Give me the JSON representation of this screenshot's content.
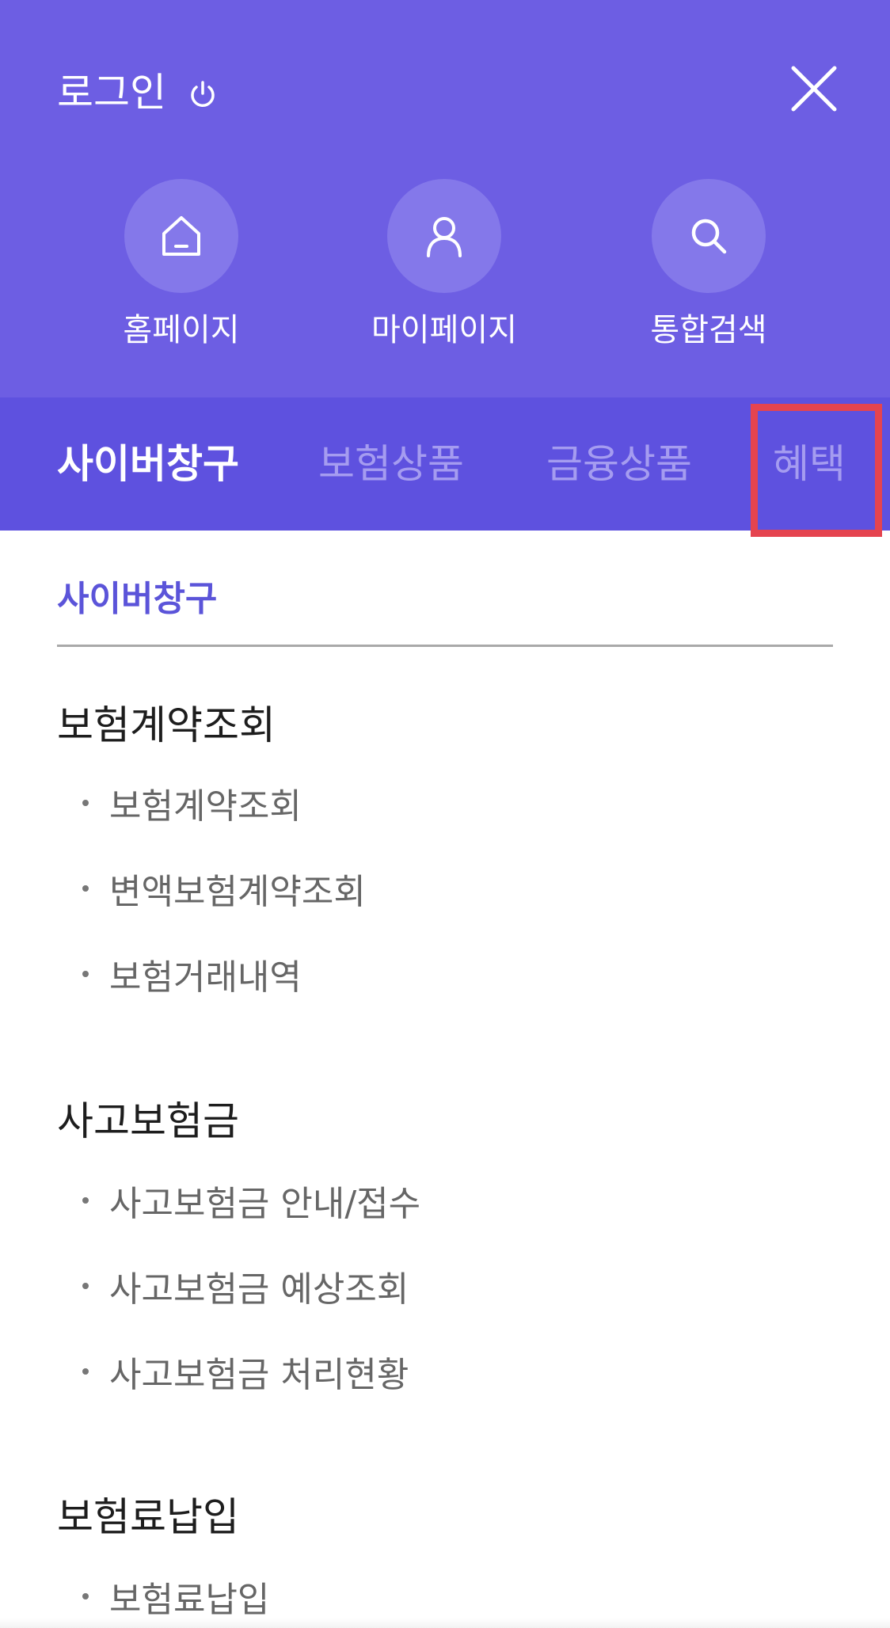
{
  "header": {
    "login_label": "로그인",
    "quick_links": [
      {
        "label": "홈페이지",
        "icon": "home-icon"
      },
      {
        "label": "마이페이지",
        "icon": "person-icon"
      },
      {
        "label": "통합검색",
        "icon": "search-icon"
      }
    ]
  },
  "tabs": [
    {
      "label": "사이버창구",
      "active": true
    },
    {
      "label": "보험상품",
      "active": false
    },
    {
      "label": "금융상품",
      "active": false
    },
    {
      "label": "혜택",
      "active": false,
      "highlighted": true
    }
  ],
  "content": {
    "section_title": "사이버창구",
    "groups": [
      {
        "title": "보험계약조회",
        "items": [
          "보험계약조회",
          "변액보험계약조회",
          "보험거래내역"
        ]
      },
      {
        "title": "사고보험금",
        "items": [
          "사고보험금 안내/접수",
          "사고보험금 예상조회",
          "사고보험금 처리현황"
        ]
      },
      {
        "title": "보험료납입",
        "items": [
          "보험료납입"
        ]
      }
    ]
  },
  "colors": {
    "header_bg": "#6d5ee3",
    "tabs_bg": "#5e51df",
    "circle_bg": "#8478ea",
    "section_title": "#5b54d9",
    "highlight_border": "#e5444f"
  }
}
